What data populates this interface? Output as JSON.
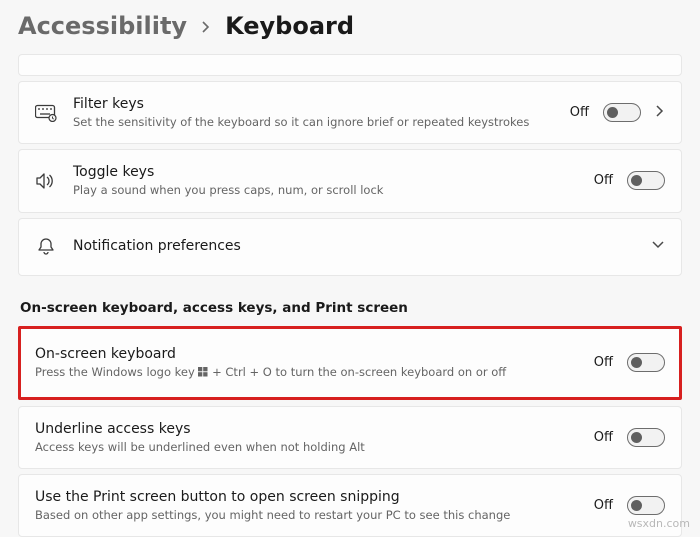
{
  "breadcrumb": {
    "parent": "Accessibility",
    "current": "Keyboard"
  },
  "rows": {
    "filter_keys": {
      "title": "Filter keys",
      "desc": "Set the sensitivity of the keyboard so it can ignore brief or repeated keystrokes",
      "state": "Off"
    },
    "toggle_keys": {
      "title": "Toggle keys",
      "desc": "Play a sound when you press caps, num, or scroll lock",
      "state": "Off"
    },
    "notification_prefs": {
      "title": "Notification preferences"
    },
    "osk": {
      "title": "On-screen keyboard",
      "desc_before": "Press the Windows logo key ",
      "desc_after": " + Ctrl + O to turn the on-screen keyboard on or off",
      "state": "Off"
    },
    "underline": {
      "title": "Underline access keys",
      "desc": "Access keys will be underlined even when not holding Alt",
      "state": "Off"
    },
    "printscreen": {
      "title": "Use the Print screen button to open screen snipping",
      "desc": "Based on other app settings, you might need to restart your PC to see this change",
      "state": "Off"
    }
  },
  "section_header": "On-screen keyboard, access keys, and Print screen",
  "watermark": "wsxdn.com"
}
